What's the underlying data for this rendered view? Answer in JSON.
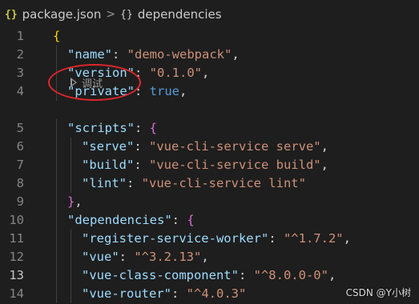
{
  "breadcrumb": {
    "file_icon": "{}",
    "file": "package.json",
    "separator": ">",
    "symbol_icon": "{}",
    "symbol": "dependencies"
  },
  "code_lens": {
    "icon": "play-icon",
    "label": "调试"
  },
  "watermark": "CSDN @Y小树",
  "editor": {
    "active_line": "13",
    "lines": [
      {
        "n": "1",
        "tokens": [
          {
            "t": "{",
            "c": "brace1"
          }
        ]
      },
      {
        "n": "2",
        "tokens": [
          {
            "t": "\"name\"",
            "c": "key"
          },
          {
            "t": ": ",
            "c": "punc"
          },
          {
            "t": "\"demo-webpack\"",
            "c": "str"
          },
          {
            "t": ",",
            "c": "punc"
          }
        ]
      },
      {
        "n": "3",
        "tokens": [
          {
            "t": "\"version\"",
            "c": "key"
          },
          {
            "t": ": ",
            "c": "punc"
          },
          {
            "t": "\"0.1.0\"",
            "c": "str"
          },
          {
            "t": ",",
            "c": "punc"
          }
        ]
      },
      {
        "n": "4",
        "tokens": [
          {
            "t": "\"private\"",
            "c": "key"
          },
          {
            "t": ": ",
            "c": "punc"
          },
          {
            "t": "true",
            "c": "kw"
          },
          {
            "t": ",",
            "c": "punc"
          }
        ]
      },
      {
        "n": "5",
        "tokens": [
          {
            "t": "\"scripts\"",
            "c": "key"
          },
          {
            "t": ": ",
            "c": "punc"
          },
          {
            "t": "{",
            "c": "brace2"
          }
        ]
      },
      {
        "n": "6",
        "tokens": [
          {
            "t": "\"serve\"",
            "c": "key"
          },
          {
            "t": ": ",
            "c": "punc"
          },
          {
            "t": "\"vue-cli-service serve\"",
            "c": "str"
          },
          {
            "t": ",",
            "c": "punc"
          }
        ]
      },
      {
        "n": "7",
        "tokens": [
          {
            "t": "\"build\"",
            "c": "key"
          },
          {
            "t": ": ",
            "c": "punc"
          },
          {
            "t": "\"vue-cli-service build\"",
            "c": "str"
          },
          {
            "t": ",",
            "c": "punc"
          }
        ]
      },
      {
        "n": "8",
        "tokens": [
          {
            "t": "\"lint\"",
            "c": "key"
          },
          {
            "t": ": ",
            "c": "punc"
          },
          {
            "t": "\"vue-cli-service lint\"",
            "c": "str"
          }
        ]
      },
      {
        "n": "9",
        "tokens": [
          {
            "t": "}",
            "c": "brace2"
          },
          {
            "t": ",",
            "c": "punc"
          }
        ]
      },
      {
        "n": "10",
        "tokens": [
          {
            "t": "\"dependencies\"",
            "c": "key"
          },
          {
            "t": ": ",
            "c": "punc"
          },
          {
            "t": "{",
            "c": "brace2"
          }
        ]
      },
      {
        "n": "11",
        "tokens": [
          {
            "t": "\"register-service-worker\"",
            "c": "key"
          },
          {
            "t": ": ",
            "c": "punc"
          },
          {
            "t": "\"^1.7.2\"",
            "c": "str"
          },
          {
            "t": ",",
            "c": "punc"
          }
        ]
      },
      {
        "n": "12",
        "tokens": [
          {
            "t": "\"vue\"",
            "c": "key"
          },
          {
            "t": ": ",
            "c": "punc"
          },
          {
            "t": "\"^3.2.13\"",
            "c": "str"
          },
          {
            "t": ",",
            "c": "punc"
          }
        ]
      },
      {
        "n": "13",
        "tokens": [
          {
            "t": "\"vue-class-component\"",
            "c": "key"
          },
          {
            "t": ": ",
            "c": "punc"
          },
          {
            "t": "\"^8.0.0-0\"",
            "c": "str"
          },
          {
            "t": ",",
            "c": "punc"
          }
        ]
      },
      {
        "n": "14",
        "tokens": [
          {
            "t": "\"vue-router\"",
            "c": "key"
          },
          {
            "t": ": ",
            "c": "punc"
          },
          {
            "t": "\"^4.0.3\"",
            "c": "str"
          }
        ]
      }
    ]
  }
}
